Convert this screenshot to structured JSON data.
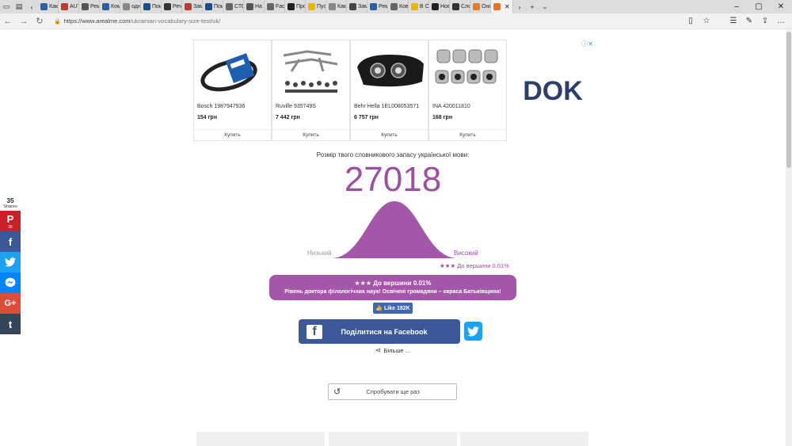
{
  "browser": {
    "tabs": [
      {
        "label": "Как",
        "color": "#2c5fa8"
      },
      {
        "label": "AUT",
        "color": "#c0392b"
      },
      {
        "label": "Рем",
        "color": "#555555"
      },
      {
        "label": "Ком",
        "color": "#2c5fa8"
      },
      {
        "label": "одн",
        "color": "#888888"
      },
      {
        "label": "Пои",
        "color": "#1a4d8f"
      },
      {
        "label": "Речі",
        "color": "#333333"
      },
      {
        "label": "Зам",
        "color": "#c0392b"
      },
      {
        "label": "Пои",
        "color": "#1a4d8f"
      },
      {
        "label": "СТО",
        "color": "#666666"
      },
      {
        "label": "На с",
        "color": "#555555"
      },
      {
        "label": "Faq",
        "color": "#666666"
      },
      {
        "label": "Прс",
        "color": "#222222"
      },
      {
        "label": "Пус",
        "color": "#e8b800"
      },
      {
        "label": "Как",
        "color": "#888888"
      },
      {
        "label": "Зам",
        "color": "#444444"
      },
      {
        "label": "Рем",
        "color": "#2c5fa8"
      },
      {
        "label": "Ков",
        "color": "#666666"
      },
      {
        "label": "В От",
        "color": "#e8b800"
      },
      {
        "label": "Нов",
        "color": "#222222"
      },
      {
        "label": "Сло",
        "color": "#333333"
      },
      {
        "label": "Онл",
        "color": "#e67e22"
      }
    ],
    "active_tab": {
      "color": "#e8741e"
    },
    "url_host": "https://www.arealme.com",
    "url_path": "/ukrainian-vocabulary-size-test/uk/"
  },
  "ad": {
    "products": [
      {
        "name": "Bosch 1987947936",
        "price": "154 грн",
        "buy": "Купить"
      },
      {
        "name": "Ruville 935749S",
        "price": "7 442 грн",
        "buy": "Купить"
      },
      {
        "name": "Behr Hella 1EL008053571",
        "price": "6 757 грн",
        "buy": "Купить"
      },
      {
        "name": "INA 420011810",
        "price": "168 грн",
        "buy": "Купить"
      }
    ],
    "brand_logo_text": "DOK"
  },
  "share_sidebar": {
    "count": "35",
    "label": "Shares",
    "pinterest_count": "35",
    "colors": {
      "pinterest": "#cb2027",
      "facebook": "#3b5998",
      "twitter": "#1da1f2",
      "messenger": "#0084ff",
      "google": "#dd4b39",
      "tumblr": "#35465c"
    }
  },
  "result": {
    "title": "Розмір твого словникового запасу української мови:",
    "score": "27018",
    "low_label": "Низький",
    "high_label": "Високий",
    "top_note": "★★★ До вершини 0.01%",
    "banner_line1": "★★★ До вершини 0.01%",
    "banner_line2": "Рівень доктора філологічних наук! Освічені громадяни – окраса Батьківщини!",
    "accent": "#a456a8"
  },
  "social": {
    "like_label": "Like 182K",
    "fb_share_label": "Поділитися на Facebook",
    "more_label": "Більше ..."
  },
  "retry": {
    "label": "Спробувати ще раз"
  }
}
